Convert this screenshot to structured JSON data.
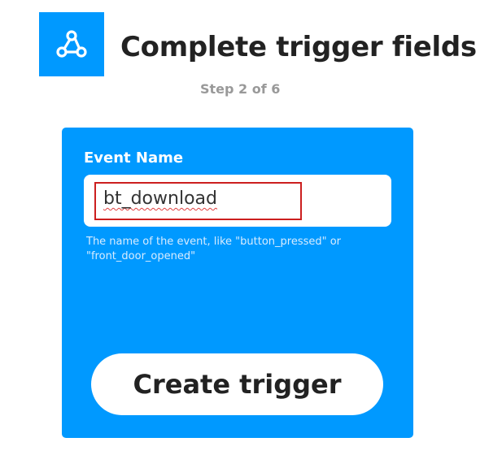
{
  "header": {
    "logo_icon": "webhooks-icon",
    "title": "Complete trigger fields",
    "step": "Step 2 of 6"
  },
  "form": {
    "field_label": "Event Name",
    "event_name_value": "bt_download",
    "helper_text": "The name of the event, like \"button_pressed\" or \"front_door_opened\"",
    "submit_label": "Create trigger"
  },
  "colors": {
    "brand_blue": "#0099ff",
    "highlight_red": "#cc1f1f"
  }
}
